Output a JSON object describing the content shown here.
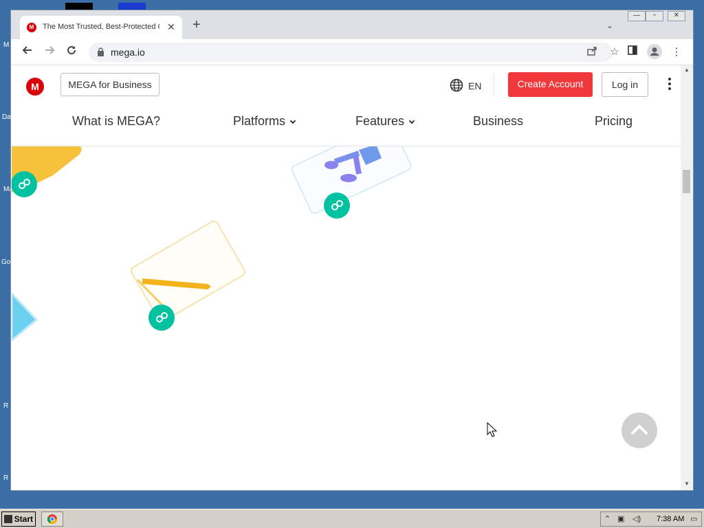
{
  "desktop": {
    "icon_labels": [
      "M",
      "Da",
      "Ma",
      "Go",
      "R",
      "R"
    ]
  },
  "browser": {
    "tab": {
      "title": "The Most Trusted, Best-Protected C",
      "favicon": "M",
      "close": "✕"
    },
    "new_tab": "+",
    "tab_dropdown": "⌄",
    "window_controls": [
      "—",
      "▫",
      "✕"
    ],
    "url": "mega.io"
  },
  "site": {
    "logo": "M",
    "business_button": "MEGA for Business",
    "language": "EN",
    "create_account": "Create Account",
    "login": "Log in",
    "nav": [
      {
        "label": "What is MEGA?"
      },
      {
        "label": "Platforms"
      },
      {
        "label": "Features"
      },
      {
        "label": "Business"
      },
      {
        "label": "Pricing"
      }
    ]
  },
  "taskbar": {
    "start": "Start",
    "time": "7:38 AM"
  },
  "colors": {
    "brand_red": "#d90007",
    "cta_red": "#f0373a",
    "teal": "#00c1a0",
    "yellow": "#f7c23b",
    "blue_icon": "#5c9ee8",
    "purple_icon": "#8c82f0"
  }
}
